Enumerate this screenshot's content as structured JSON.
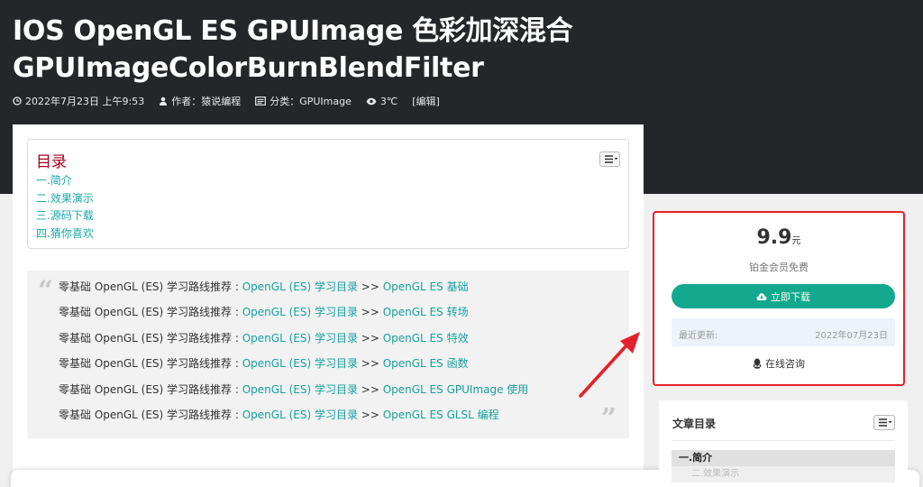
{
  "article": {
    "title_line1": "IOS OpenGL ES GPUImage 色彩加深混合",
    "title_line2": "GPUImageColorBurnBlendFilter",
    "meta": {
      "date": "2022年7月23日 上午9:53",
      "author": "作者：猿说编程",
      "category": "分类：GPUImage",
      "views": "3℃",
      "edit": "[编辑]"
    }
  },
  "toc": {
    "title": "目录",
    "items": [
      "一.简介",
      "二.效果演示",
      "三.源码下载",
      "四.猜你喜欢"
    ]
  },
  "quote": {
    "prefix": "零基础 OpenGL (ES) 学习路线推荐 : ",
    "index_link": "OpenGL (ES) 学习目录",
    "separator": " >> ",
    "topics": [
      "OpenGL ES 基础",
      "OpenGL ES 转场",
      "OpenGL ES 特效",
      "OpenGL ES 函数",
      "OpenGL ES GPUImage 使用",
      "OpenGL ES GLSL 编程"
    ],
    "open_mark": "“",
    "close_mark": "”"
  },
  "price_box": {
    "price": "9.9",
    "unit": "元",
    "member_note": "铂金会员免费",
    "download_label": "立即下载",
    "update_label": "最近更新:",
    "update_date": "2022年07月23日",
    "consult_label": "在线咨询"
  },
  "toc_widget": {
    "title": "文章目录",
    "first_item": "一.简介",
    "second_item": "二.效果演示"
  },
  "popup": {
    "close": "×"
  },
  "colors": {
    "hero_bg": "#24262a",
    "accent_teal": "#17a0a0",
    "download_green": "#14a88e",
    "highlight_red": "#e5212b",
    "toc_title_red": "#a8001e"
  }
}
